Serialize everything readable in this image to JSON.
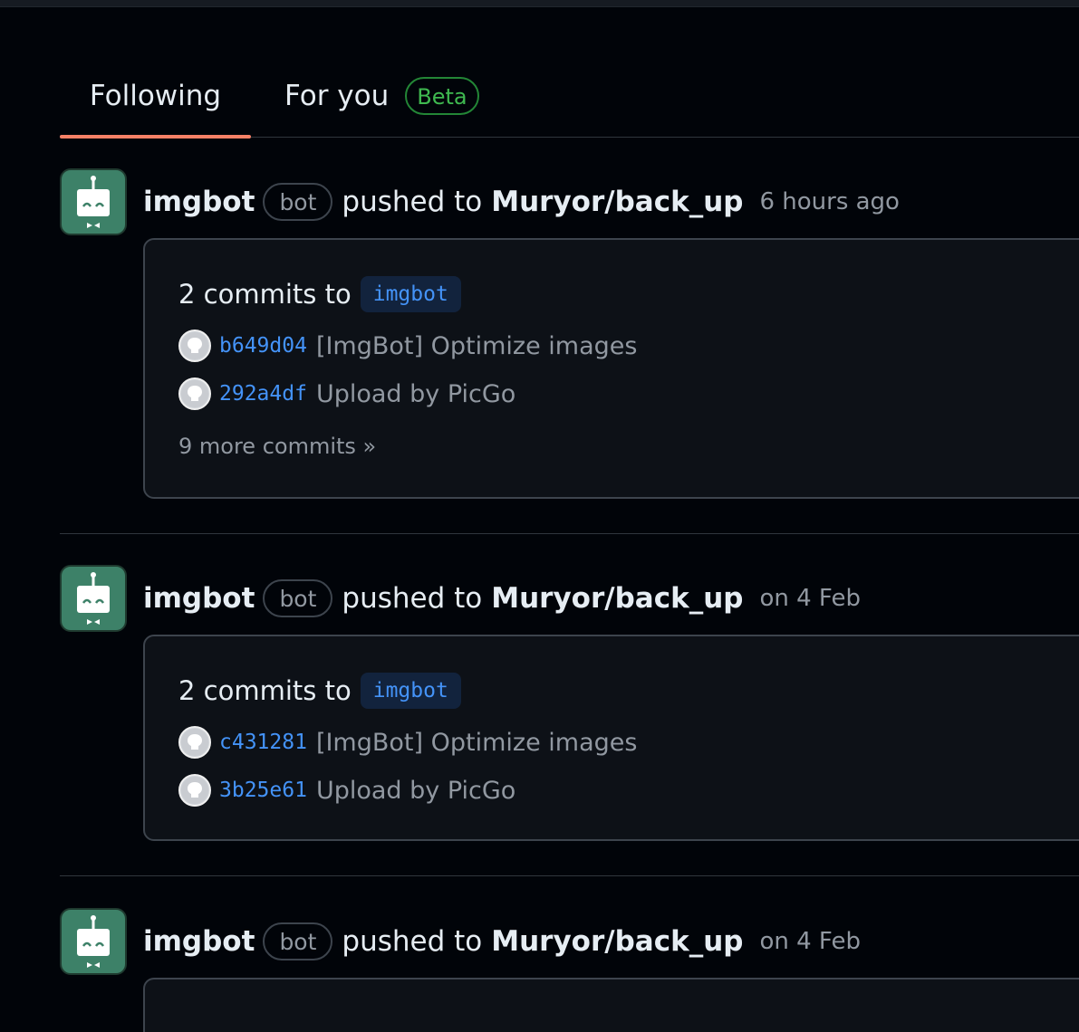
{
  "tabs": [
    {
      "label": "Following",
      "active": true
    },
    {
      "label": "For you",
      "badge": "Beta"
    }
  ],
  "colors": {
    "background": "#010409",
    "card": "#0d1117",
    "link": "#4493f8",
    "active_tab_underline": "#f78166",
    "beta_green": "#3fb950",
    "imgbot_avatar": "#3d8168"
  },
  "feed": [
    {
      "actor": "imgbot",
      "badge": "bot",
      "verb": "pushed to",
      "repo": "Muryor/back_up",
      "time": "6 hours ago",
      "card": {
        "title_prefix": "2 commits to",
        "branch": "imgbot",
        "commits": [
          {
            "sha": "b649d04",
            "message": "[ImgBot] Optimize images"
          },
          {
            "sha": "292a4df",
            "message": "Upload by PicGo"
          }
        ],
        "more": "9 more commits »"
      }
    },
    {
      "actor": "imgbot",
      "badge": "bot",
      "verb": "pushed to",
      "repo": "Muryor/back_up",
      "time": "on 4 Feb",
      "card": {
        "title_prefix": "2 commits to",
        "branch": "imgbot",
        "commits": [
          {
            "sha": "c431281",
            "message": "[ImgBot] Optimize images"
          },
          {
            "sha": "3b25e61",
            "message": "Upload by PicGo"
          }
        ]
      }
    },
    {
      "actor": "imgbot",
      "badge": "bot",
      "verb": "pushed to",
      "repo": "Muryor/back_up",
      "time": "on 4 Feb"
    }
  ]
}
